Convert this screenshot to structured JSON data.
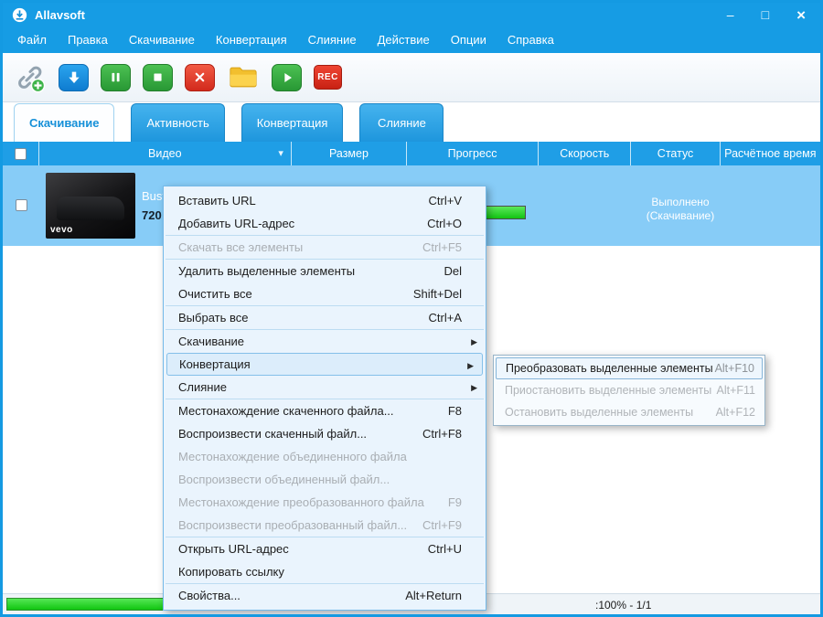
{
  "window": {
    "title": "Allavsoft",
    "controls": {
      "minimize": "–",
      "maximize": "□",
      "close": "×"
    }
  },
  "menubar": {
    "items": [
      "Файл",
      "Правка",
      "Скачивание",
      "Конвертация",
      "Слияние",
      "Действие",
      "Опции",
      "Справка"
    ]
  },
  "toolbar": {
    "rec_label": "REC",
    "icons": [
      "add-url-link",
      "download-arrow",
      "pause",
      "stop",
      "delete-x",
      "open-folder",
      "play-convert",
      "record"
    ]
  },
  "tabs": [
    {
      "label": "Скачивание",
      "active": true
    },
    {
      "label": "Активность",
      "active": false
    },
    {
      "label": "Конвертация",
      "active": false
    },
    {
      "label": "Слияние",
      "active": false
    }
  ],
  "table": {
    "columns": [
      "Видео",
      "Размер",
      "Прогресс",
      "Скорость",
      "Статус",
      "Расчётное время"
    ],
    "row": {
      "title": "Bust",
      "quality": "720",
      "thumbnail_brand": "vevo",
      "progress_percent": 100,
      "status": [
        "Выполнено",
        "(Скачивание)"
      ]
    }
  },
  "context_menu": {
    "items": [
      {
        "label": "Вставить URL",
        "shortcut": "Ctrl+V"
      },
      {
        "label": "Добавить URL-адрес",
        "shortcut": "Ctrl+O"
      },
      {
        "label": "Скачать все элементы",
        "shortcut": "Ctrl+F5",
        "disabled": true
      },
      {
        "label": "Удалить выделенные элементы",
        "shortcut": "Del"
      },
      {
        "label": "Очистить все",
        "shortcut": "Shift+Del"
      },
      {
        "label": "Выбрать все",
        "shortcut": "Ctrl+A"
      },
      {
        "label": "Скачивание",
        "submenu": true
      },
      {
        "label": "Конвертация",
        "submenu": true,
        "highlighted": true
      },
      {
        "label": "Слияние",
        "submenu": true
      },
      {
        "label": "Местонахождение скаченного файла...",
        "shortcut": "F8"
      },
      {
        "label": "Воспроизвести скаченный файл...",
        "shortcut": "Ctrl+F8"
      },
      {
        "label": "Местонахождение объединенного файла",
        "disabled": true
      },
      {
        "label": "Воспроизвести объединенный файл...",
        "disabled": true
      },
      {
        "label": "Местонахождение преобразованного файла",
        "shortcut": "F9",
        "disabled": true
      },
      {
        "label": "Воспроизвести преобразованный файл...",
        "shortcut": "Ctrl+F9",
        "disabled": true
      },
      {
        "label": "Открыть URL-адрес",
        "shortcut": "Ctrl+U"
      },
      {
        "label": "Копировать ссылку"
      },
      {
        "label": "Свойства...",
        "shortcut": "Alt+Return"
      }
    ]
  },
  "submenu": {
    "items": [
      {
        "label": "Преобразовать выделенные элементы",
        "shortcut": "Alt+F10",
        "selected": true
      },
      {
        "label": "Приостановить выделенные элементы",
        "shortcut": "Alt+F11",
        "disabled": true
      },
      {
        "label": "Остановить выделенные элементы",
        "shortcut": "Alt+F12",
        "disabled": true
      }
    ]
  },
  "statusbar": {
    "progress_text": ":100% - 1/1",
    "progress_percent": 100
  },
  "colors": {
    "titlebar_blue": "#169ce4",
    "header_blue": "#1f9ee6",
    "selected_row_blue": "#87ccf7",
    "progress_green": "#1cd41c",
    "rec_red": "#d92b1c"
  }
}
